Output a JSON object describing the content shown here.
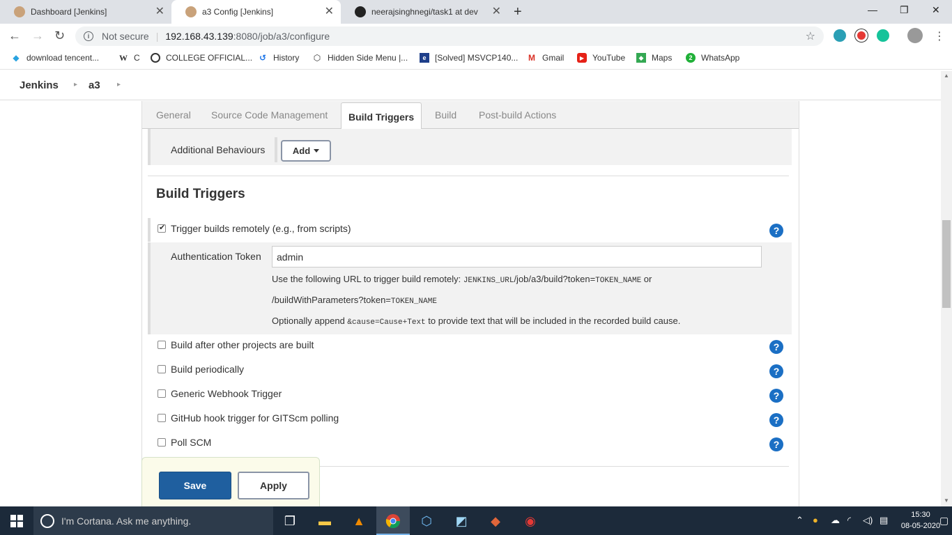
{
  "browser": {
    "tabs": [
      {
        "title": "Dashboard [Jenkins]",
        "active": false
      },
      {
        "title": "a3 Config [Jenkins]",
        "active": true
      },
      {
        "title": "neerajsinghnegi/task1 at dev",
        "active": false
      }
    ],
    "new_tab_icon": "plus-icon",
    "address": {
      "security": "Not secure",
      "host": "192.168.43.139",
      "path": ":8080/job/a3/configure"
    },
    "bookmarks": [
      {
        "label": "download tencent...",
        "icon": "download-icon"
      },
      {
        "label": "C",
        "icon": "wikipedia-icon"
      },
      {
        "label": "COLLEGE OFFICIAL...",
        "icon": "college-icon"
      },
      {
        "label": "History",
        "icon": "history-icon"
      },
      {
        "label": "Hidden Side Menu |...",
        "icon": "codepen-icon"
      },
      {
        "label": "[Solved] MSVCP140...",
        "icon": "solved-icon"
      },
      {
        "label": "Gmail",
        "icon": "gmail-icon"
      },
      {
        "label": "YouTube",
        "icon": "youtube-icon"
      },
      {
        "label": "Maps",
        "icon": "maps-icon"
      },
      {
        "label": "WhatsApp",
        "icon": "whatsapp-icon"
      }
    ]
  },
  "jenkins": {
    "breadcrumb": [
      "Jenkins",
      "a3"
    ],
    "config_tabs": [
      "General",
      "Source Code Management",
      "Build Triggers",
      "Build",
      "Post-build Actions"
    ],
    "active_tab": "Build Triggers",
    "additional_behaviours": {
      "label": "Additional Behaviours",
      "button": "Add"
    },
    "section_title": "Build Triggers",
    "triggers": [
      {
        "label": "Trigger builds remotely (e.g., from scripts)",
        "checked": true
      },
      {
        "label": "Build after other projects are built",
        "checked": false
      },
      {
        "label": "Build periodically",
        "checked": false
      },
      {
        "label": "Generic Webhook Trigger",
        "checked": false
      },
      {
        "label": "GitHub hook trigger for GITScm polling",
        "checked": false
      },
      {
        "label": "Poll SCM",
        "checked": false
      }
    ],
    "auth": {
      "label": "Authentication Token",
      "value": "admin",
      "note1_prefix": "Use the following URL to trigger build remotely: ",
      "note1_code1": "JENKINS_URL",
      "note1_mid": "/job/a3/build?token=",
      "note1_code2": "TOKEN_NAME",
      "note1_suffix": " or",
      "note2_prefix": "/buildWithParameters?token=",
      "note2_code": "TOKEN_NAME",
      "note3_prefix": "Optionally append ",
      "note3_code": "&cause=Cause+Text",
      "note3_suffix": " to provide text that will be included in the recorded build cause."
    },
    "save_label": "Save",
    "apply_label": "Apply"
  },
  "taskbar": {
    "search_placeholder": "I'm Cortana. Ask me anything.",
    "time": "15:30",
    "date": "08-05-2020"
  }
}
